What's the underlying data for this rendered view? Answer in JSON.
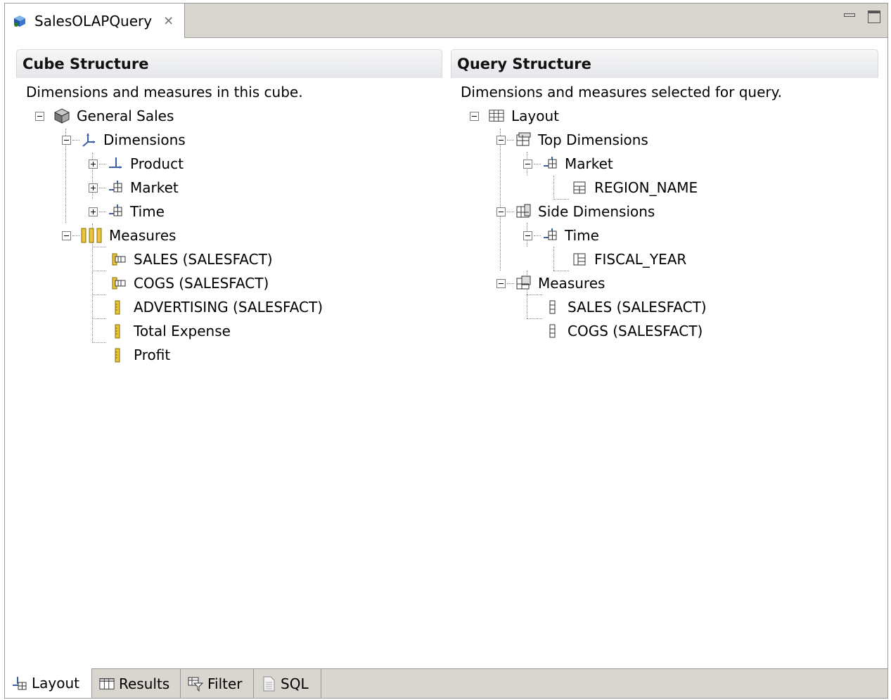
{
  "editor": {
    "tab_title": "SalesOLAPQuery",
    "close_glyph": "⨯"
  },
  "cube_structure": {
    "title": "Cube Structure",
    "description": "Dimensions and measures in this cube.",
    "root": "General Sales",
    "dimensions_label": "Dimensions",
    "dimensions": [
      "Product",
      "Market",
      "Time"
    ],
    "measures_label": "Measures",
    "measures": [
      "SALES (SALESFACT)",
      "COGS (SALESFACT)",
      "ADVERTISING (SALESFACT)",
      "Total Expense",
      "Profit"
    ]
  },
  "query_structure": {
    "title": "Query Structure",
    "description": "Dimensions and measures selected for query.",
    "root": "Layout",
    "top_dimensions_label": "Top Dimensions",
    "top_dimension": "Market",
    "top_level": "REGION_NAME",
    "side_dimensions_label": "Side Dimensions",
    "side_dimension": "Time",
    "side_level": "FISCAL_YEAR",
    "measures_label": "Measures",
    "measures": [
      "SALES (SALESFACT)",
      "COGS (SALESFACT)"
    ]
  },
  "bottom_tabs": [
    "Layout",
    "Results",
    "Filter",
    "SQL"
  ],
  "active_tab": "Layout",
  "icons": {
    "editor": "cube-query-icon",
    "cube": "cube-icon",
    "dimensions": "axes-icon",
    "dimension": "dimension-hierarchy-icon",
    "measures_folder": "ruler-folder-icon",
    "measure": "ruler-icon",
    "calculated_measure": "table-measure-icon",
    "layout": "grid-icon",
    "edge": "edge-table-icon",
    "level": "level-icon"
  },
  "colors": {
    "tab_bar": "#d9d6cf",
    "ruler_yellow": "#e8c53a",
    "axes_blue": "#3a5fa8"
  }
}
